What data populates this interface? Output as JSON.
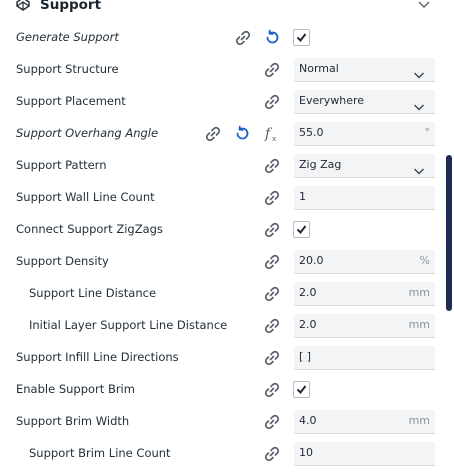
{
  "category": {
    "title": "Support",
    "icon": "support-category-icon",
    "collapse_icon": "chevron-down-icon"
  },
  "settings": [
    {
      "id": "generate-support",
      "label": "Generate Support",
      "italic": true,
      "control": "checkbox",
      "checked": true,
      "reset": true,
      "fx": false
    },
    {
      "id": "support-structure",
      "label": "Support Structure",
      "control": "dropdown",
      "value": "Normal"
    },
    {
      "id": "support-placement",
      "label": "Support Placement",
      "control": "dropdown",
      "value": "Everywhere"
    },
    {
      "id": "support-overhang-angle",
      "label": "Support Overhang Angle",
      "italic": true,
      "control": "text",
      "value": "55.0",
      "unit": "°",
      "reset": true,
      "fx": true
    },
    {
      "id": "support-pattern",
      "label": "Support Pattern",
      "control": "dropdown",
      "value": "Zig Zag"
    },
    {
      "id": "support-wall-line-count",
      "label": "Support Wall Line Count",
      "control": "text",
      "value": "1",
      "unit": ""
    },
    {
      "id": "connect-support-zigzags",
      "label": "Connect Support ZigZags",
      "control": "checkbox",
      "checked": true
    },
    {
      "id": "support-density",
      "label": "Support Density",
      "control": "text",
      "value": "20.0",
      "unit": "%"
    },
    {
      "id": "support-line-distance",
      "label": "Support Line Distance",
      "indent": true,
      "control": "text",
      "value": "2.0",
      "unit": "mm"
    },
    {
      "id": "initial-layer-support-line-distance",
      "label": "Initial Layer Support Line Distance",
      "indent": true,
      "control": "text",
      "value": "2.0",
      "unit": "mm"
    },
    {
      "id": "support-infill-line-directions",
      "label": "Support Infill Line Directions",
      "control": "text",
      "value": "[ ]",
      "unit": ""
    },
    {
      "id": "enable-support-brim",
      "label": "Enable Support Brim",
      "control": "checkbox",
      "checked": true
    },
    {
      "id": "support-brim-width",
      "label": "Support Brim Width",
      "control": "text",
      "value": "4.0",
      "unit": "mm"
    },
    {
      "id": "support-brim-line-count",
      "label": "Support Brim Line Count",
      "indent": true,
      "control": "text",
      "value": "10",
      "unit": ""
    }
  ],
  "colors": {
    "link_icon": "#555f69",
    "reset_icon": "#1f62c4",
    "scrollbar": "#1f2a55"
  }
}
